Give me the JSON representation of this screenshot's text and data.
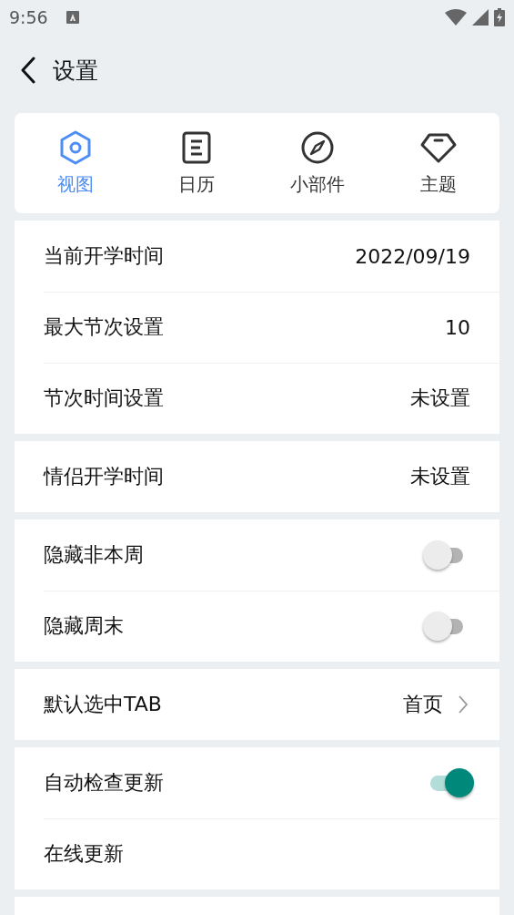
{
  "status_bar": {
    "time": "9:56"
  },
  "header": {
    "title": "设置"
  },
  "tabs": [
    {
      "label": "视图",
      "kind": "view",
      "selected": true
    },
    {
      "label": "日历",
      "kind": "calendar",
      "selected": false
    },
    {
      "label": "小部件",
      "kind": "widget",
      "selected": false
    },
    {
      "label": "主题",
      "kind": "theme",
      "selected": false
    }
  ],
  "groups": [
    {
      "rows": [
        {
          "kind": "value",
          "label": "当前开学时间",
          "value": "2022/09/19"
        },
        {
          "kind": "value",
          "label": "最大节次设置",
          "value": "10"
        },
        {
          "kind": "value",
          "label": "节次时间设置",
          "value": "未设置"
        }
      ]
    },
    {
      "rows": [
        {
          "kind": "value",
          "label": "情侣开学时间",
          "value": "未设置"
        }
      ]
    },
    {
      "rows": [
        {
          "kind": "toggle",
          "label": "隐藏非本周",
          "on": false
        },
        {
          "kind": "toggle",
          "label": "隐藏周末",
          "on": false
        }
      ]
    },
    {
      "rows": [
        {
          "kind": "link",
          "label": "默认选中TAB",
          "value": "首页"
        }
      ]
    },
    {
      "rows": [
        {
          "kind": "toggle",
          "label": "自动检查更新",
          "on": true
        },
        {
          "kind": "plain",
          "label": "在线更新"
        }
      ]
    }
  ]
}
